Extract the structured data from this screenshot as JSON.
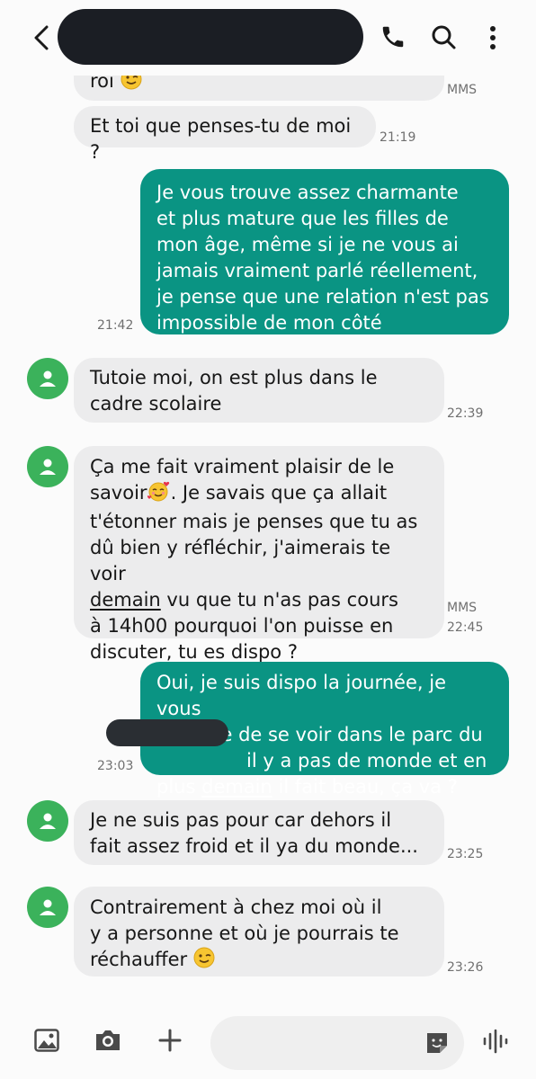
{
  "messages": [
    {
      "id": "m0",
      "dir": "in",
      "lines": [
        "roi"
      ],
      "emoji": "wink-emoji",
      "meta_top": "MMS"
    },
    {
      "id": "m1",
      "dir": "in",
      "text": "Et toi que penses-tu de moi ?",
      "time": "21:19"
    },
    {
      "id": "m2",
      "dir": "out",
      "lines": [
        "Je vous trouve assez charmante",
        "et plus mature que les filles de",
        "mon âge, même si je ne vous ai",
        "jamais vraiment parlé réellement,",
        "je pense que une relation n'est pas",
        "impossible de mon côté"
      ],
      "time": "21:42"
    },
    {
      "id": "m3",
      "dir": "in",
      "lines": [
        "Tutoie moi, on est plus dans le",
        "cadre scolaire"
      ],
      "time": "22:39"
    },
    {
      "id": "m4",
      "dir": "in",
      "lines": [
        "Ça me fait vraiment plaisir de le",
        "savoir",
        "Je savais que ça allait",
        "t'étonner mais je penses que tu as",
        "dû bien y réfléchir, j'aimerais te voir",
        "demain",
        "vu que tu n'as pas cours",
        "à 14h00 pourquoi l'on puisse en",
        "discuter, tu es dispo ?"
      ],
      "emoji": "smiling-hearts-emoji",
      "meta_top": "MMS",
      "time": "22:45"
    },
    {
      "id": "m5",
      "dir": "out",
      "lines": [
        "Oui, je suis dispo la journée, je vous",
        "propose de se voir dans le parc du",
        "il y a pas de monde et en",
        "plus",
        "demain",
        "il fait beau, ça va ?"
      ],
      "time": "23:03"
    },
    {
      "id": "m6",
      "dir": "in",
      "lines": [
        "Je ne suis pas pour car dehors il",
        "fait assez froid et il ya du monde..."
      ],
      "time": "23:25"
    },
    {
      "id": "m7",
      "dir": "in",
      "lines": [
        "Contrairement à chez moi où il",
        "y a personne et où je pourrais te",
        "réchauffer"
      ],
      "emoji": "wink-emoji",
      "time": "23:26"
    }
  ],
  "icons": {
    "back": "back-arrow-icon",
    "phone": "phone-icon",
    "search": "search-icon",
    "more": "more-vert-icon",
    "gallery": "image-icon",
    "camera": "camera-icon",
    "add": "plus-icon",
    "sticker": "sticker-icon",
    "voice": "voice-icon"
  },
  "colors": {
    "outgoing": "#0a9483",
    "incoming": "#ececed",
    "avatar": "#3bb25b"
  }
}
